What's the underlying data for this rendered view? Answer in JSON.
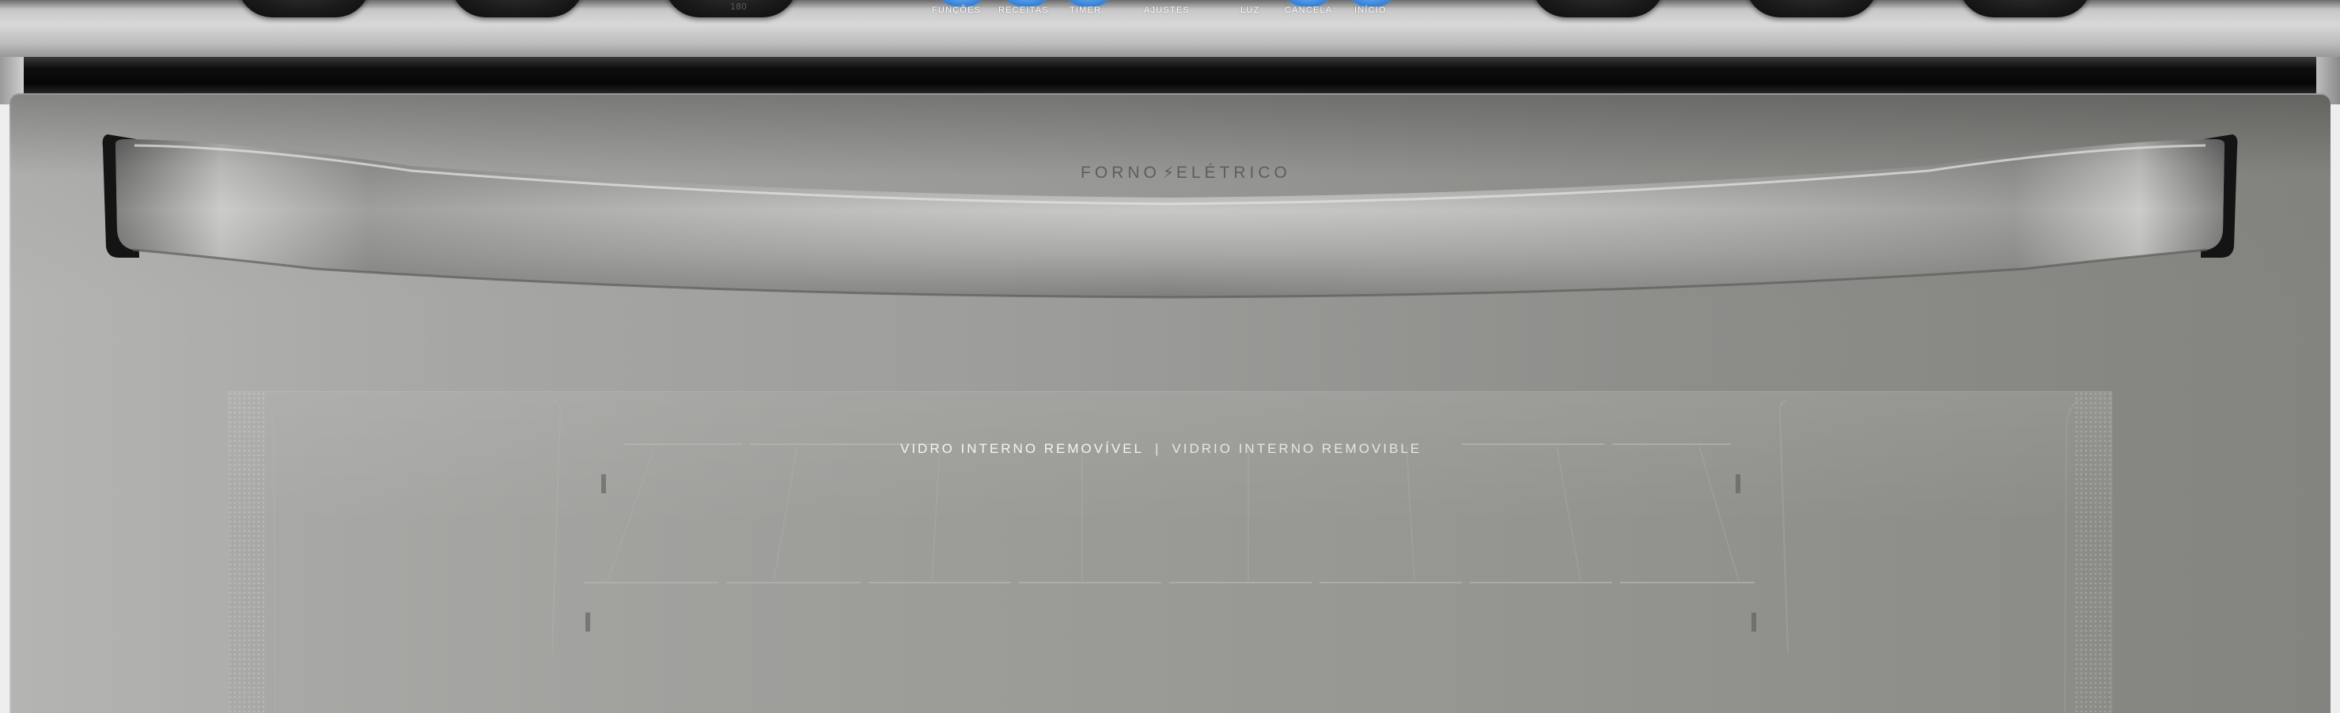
{
  "control_panel": {
    "buttons": [
      {
        "label": "FUNÇÕES"
      },
      {
        "label": "RECEITAS"
      },
      {
        "label": "TIMER"
      },
      {
        "label": "AJUSTES"
      },
      {
        "label": "LUZ"
      },
      {
        "label": "CANCELA"
      },
      {
        "label": "INÍCIO"
      }
    ],
    "knob_temp_label": "180",
    "accent_color": "#3c88dd"
  },
  "door": {
    "brand_left": "FORNO",
    "brand_icon": "lightning-bolt-icon",
    "brand_right": "ELÉTRICO",
    "glass_label_pt": "VIDRO INTERNO REMOVÍVEL",
    "glass_label_separator": "|",
    "glass_label_es": "VIDRIO INTERNO REMOVIBLE"
  }
}
